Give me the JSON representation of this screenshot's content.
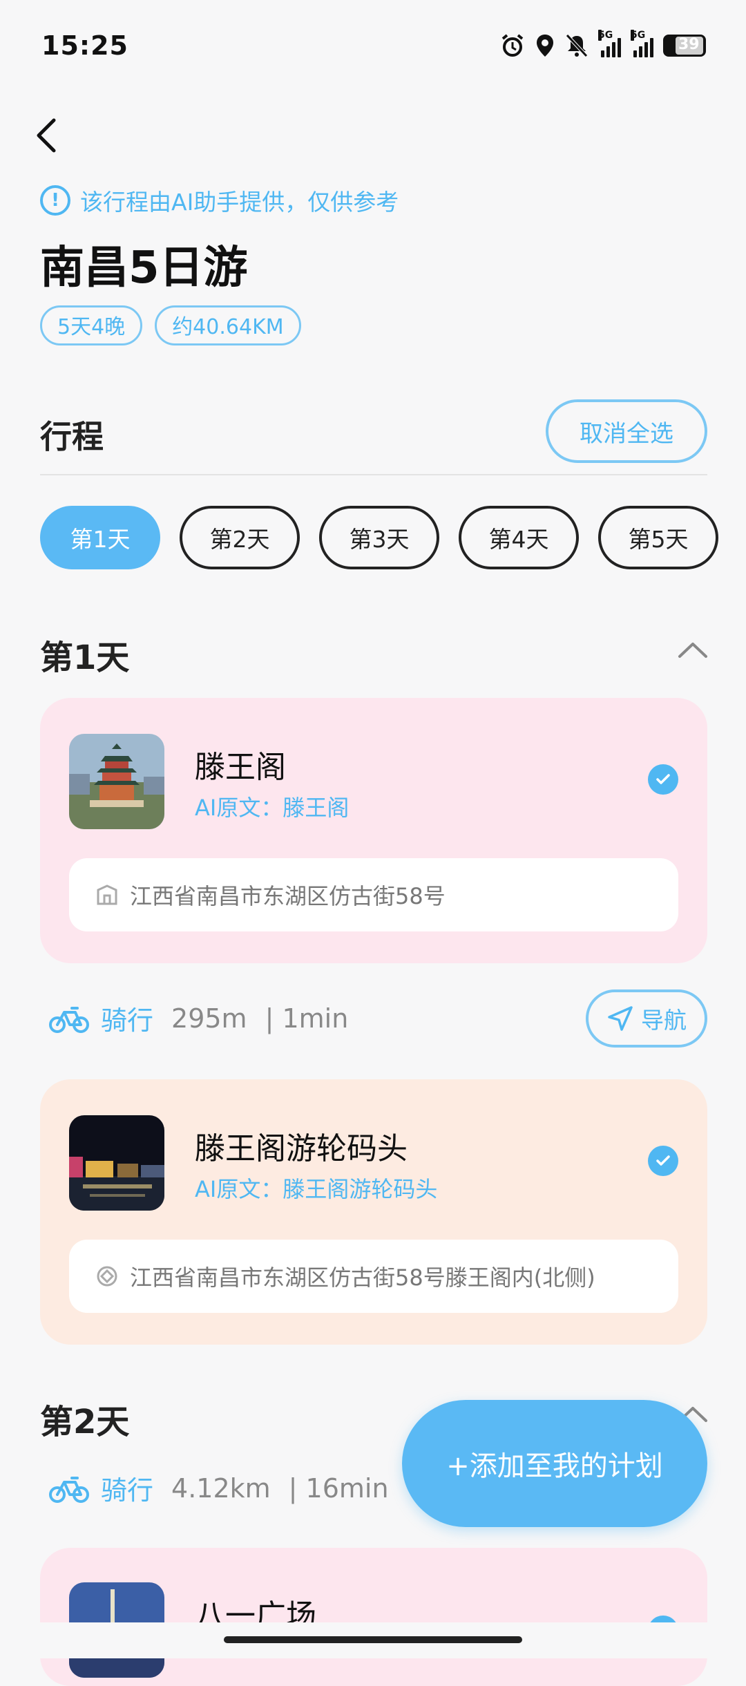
{
  "status_bar": {
    "time": "15:25",
    "network_1": "5G",
    "network_2": "5G",
    "battery": "39"
  },
  "notice": {
    "icon": "exclamation-icon",
    "text": "该行程由AI助手提供，仅供参考"
  },
  "trip": {
    "title": "南昌5日游",
    "tags": [
      "5天4晚",
      "约40.64KM"
    ]
  },
  "itinerary": {
    "label": "行程",
    "cancel_all": "取消全选"
  },
  "day_tabs": [
    "第1天",
    "第2天",
    "第3天",
    "第4天",
    "第5天"
  ],
  "days": [
    {
      "title": "第1天",
      "spots": [
        {
          "name": "滕王阁",
          "ai_original": "AI原文：滕王阁",
          "address": "江西省南昌市东湖区仿古街58号",
          "checked": true
        },
        {
          "name": "滕王阁游轮码头",
          "ai_original": "AI原文：滕王阁游轮码头",
          "address": "江西省南昌市东湖区仿古街58号滕王阁内(北侧)",
          "checked": true
        }
      ],
      "route": {
        "mode": "骑行",
        "distance": "295m",
        "duration": "| 1min",
        "nav": "导航"
      }
    },
    {
      "title": "第2天",
      "route": {
        "mode": "骑行",
        "distance": "4.12km",
        "duration": "| 16min"
      },
      "spots": [
        {
          "name": "八一广场"
        }
      ]
    }
  ],
  "fab": {
    "label": "+添加至我的计划"
  },
  "colors": {
    "accent": "#5ab9f4",
    "card_pink": "#fde6ee",
    "card_peach": "#fdebe1"
  }
}
